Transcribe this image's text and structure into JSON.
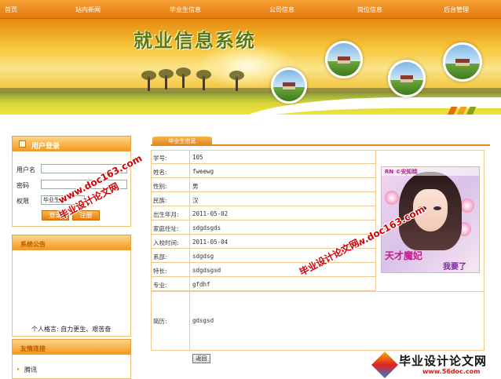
{
  "nav": {
    "items": [
      {
        "label": "首页"
      },
      {
        "label": "站内新闻"
      },
      {
        "label": "毕业生信息"
      },
      {
        "label": "公司信息"
      },
      {
        "label": "岗位信息"
      },
      {
        "label": "后台管理"
      }
    ]
  },
  "banner": {
    "title": "就业信息系统"
  },
  "login": {
    "header": "用户登录",
    "username_label": "用户名",
    "password_label": "密码",
    "role_label": "权限",
    "role_selected": "毕业生",
    "login_button": "登录",
    "register_button": "注册"
  },
  "announcement": {
    "header": "系统公告",
    "motto": "个人格言: 自力更生、艰苦奋"
  },
  "links": {
    "header": "友情连接",
    "items": [
      {
        "label": "腾讯"
      }
    ]
  },
  "detail": {
    "tab": "毕业生信息",
    "rows": [
      {
        "label": "学号:",
        "value": "105"
      },
      {
        "label": "姓名:",
        "value": "fweewg"
      },
      {
        "label": "性别:",
        "value": "男"
      },
      {
        "label": "民族:",
        "value": "汉"
      },
      {
        "label": "出生年月:",
        "value": "2011-05-02"
      },
      {
        "label": "家庭住址:",
        "value": "sdgdsgds"
      },
      {
        "label": "入校时间:",
        "value": "2011-05-04"
      },
      {
        "label": "系部:",
        "value": "sdgdsg"
      },
      {
        "label": "特长:",
        "value": "sdgdsgsd"
      },
      {
        "label": "专业:",
        "value": "gfdhf"
      }
    ],
    "resume_label": "简历:",
    "resume_value": "gdsgsd",
    "back_button": "返回"
  },
  "photo": {
    "top_text": "RN ©安知晓",
    "caption1": "天才魔妃",
    "caption2": "我要了"
  },
  "watermarks": {
    "url": "www.doc163.com",
    "site_name": "毕业设计论文网",
    "logo_name": "毕业设计论文网",
    "logo_url": "www.56doc.com"
  }
}
